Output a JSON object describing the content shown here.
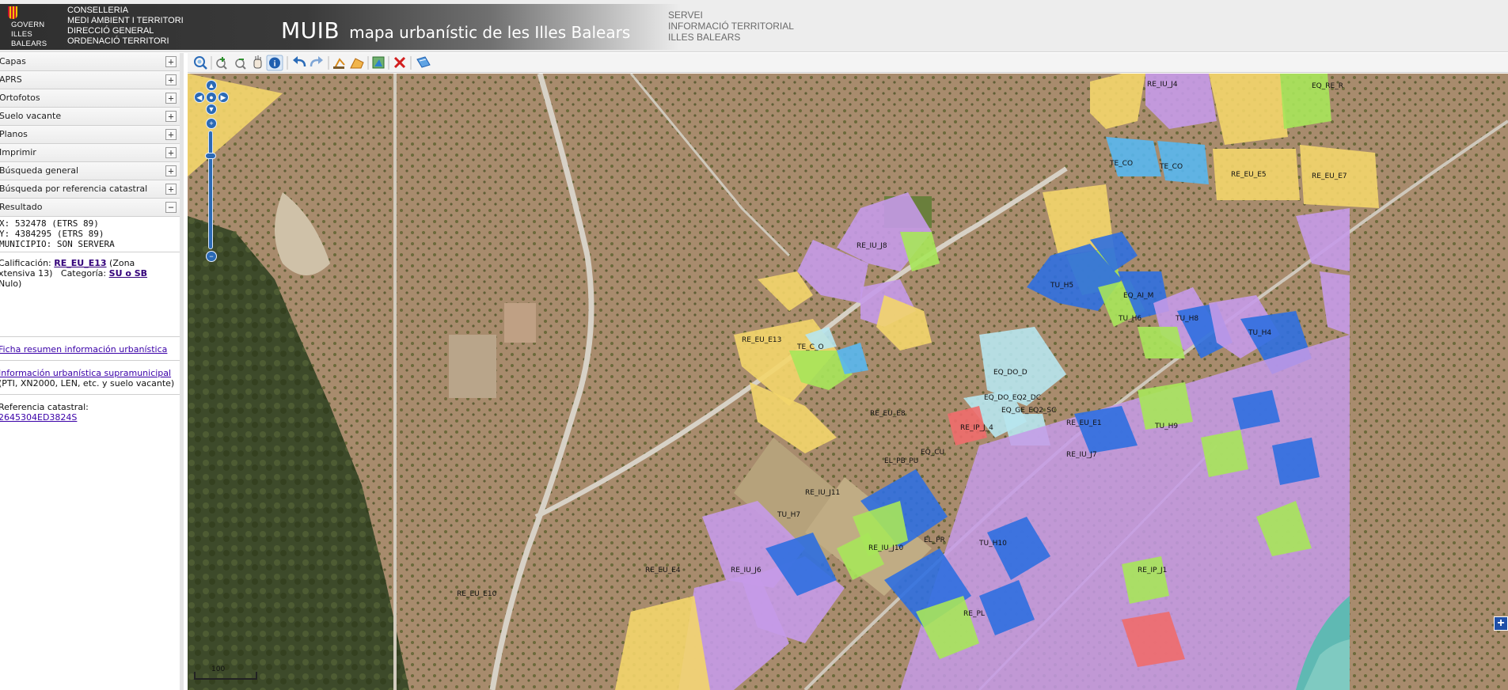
{
  "header": {
    "gov_logo_lines": [
      "GOVERN",
      "ILLES",
      "BALEARS"
    ],
    "conselleria_lines": [
      "CONSELLERIA",
      "MEDI AMBIENT I TERRITORI",
      "DIRECCIÓ GENERAL",
      "ORDENACIÓ TERRITORI"
    ],
    "app_name": "MUIB",
    "app_subtitle": "mapa urbanístic de les Illes Balears",
    "servei_lines": [
      "SERVEI",
      "INFORMACIÓ TERRITORIAL",
      "ILLES BALEARS"
    ]
  },
  "sidebar": {
    "items": [
      {
        "label": "Capas",
        "toggle": "+"
      },
      {
        "label": "APRS",
        "toggle": "+"
      },
      {
        "label": "Ortofotos",
        "toggle": "+"
      },
      {
        "label": "Suelo vacante",
        "toggle": "+"
      },
      {
        "label": "Planos",
        "toggle": "+"
      },
      {
        "label": "Imprimir",
        "toggle": "+"
      },
      {
        "label": "Búsqueda general",
        "toggle": "+"
      },
      {
        "label": "Búsqueda por referencia catastral",
        "toggle": "+"
      },
      {
        "label": "Resultado",
        "toggle": "−"
      }
    ],
    "result": {
      "x": "X: 532478 (ETRS 89)",
      "y": "Y: 4384295 (ETRS 89)",
      "municipio": "MUNICIPIO: SON SERVERA",
      "calif_prefix": "Calificación:",
      "calif_link": "RE_EU_E13",
      "calif_desc": "(Zona",
      "calif_desc2": "xtensiva 13)",
      "categoria_prefix": "Categoría:",
      "categoria_link": "SU o SB",
      "calif_desc3": "Nulo)",
      "ficha_link": "Ficha resumen información urbanística",
      "supra_link": "Información urbanística supramunicipal",
      "supra_text": "(PTI, XN2000, LEN, etc. y suelo vacante)",
      "ref_label": "Referencia catastral:",
      "ref_link": "2645304ED3824S"
    }
  },
  "toolbar": {
    "buttons": [
      {
        "name": "zoom-extent-icon",
        "color": "#2a6bb8"
      },
      {
        "name": "zoom-in-icon",
        "color": "#2f8f2f"
      },
      {
        "name": "zoom-out-icon",
        "color": "#2f8f2f"
      },
      {
        "name": "pan-hand-icon",
        "color": "#555555"
      },
      {
        "name": "info-icon",
        "color": "#1f5fb0"
      },
      {
        "name": "undo-icon",
        "color": "#2a6bb8"
      },
      {
        "name": "redo-icon",
        "color": "#2a6bb8"
      },
      {
        "name": "measure-distance-icon",
        "color": "#d78a1c"
      },
      {
        "name": "measure-area-icon",
        "color": "#d78a1c"
      },
      {
        "name": "print-map-icon",
        "color": "#3b8a3b"
      },
      {
        "name": "clear-icon",
        "color": "#d21f1f"
      },
      {
        "name": "help-book-icon",
        "color": "#2a6bb8"
      }
    ]
  },
  "map": {
    "scale_label": "100",
    "layer_switch_symbol": "+",
    "zone_labels": [
      "RE_IU_J4",
      "TE_CO",
      "TE_CO",
      "RE_EU_E5",
      "RE_EU_E7",
      "EQ_RE_R",
      "RE_IU_J8",
      "TU_H5",
      "EQ_AI_M",
      "TU_H6",
      "TU_H8",
      "TU_H4",
      "RE_EU_E13",
      "TE_C_O",
      "RE_EU_E8",
      "EQ_DO_D",
      "RE_EU_E1",
      "EQ_DO_EQ2_DC",
      "EQ_GE_EQ2_SC",
      "RE_IP_J_4",
      "TU_H9",
      "EQ_CU",
      "EL_PB_PU",
      "RE_IU_J7",
      "RE_IU_J11",
      "TU_H7",
      "EL_PR",
      "RE_IU_J10",
      "TU_H10",
      "RE_EU_E4",
      "RE_IU_J6",
      "RE_EU_E10",
      "RE_IP_J1",
      "RE_PL"
    ],
    "colors": {
      "ri_violet": "#c59ae8",
      "ri_yellow": "#f3d56a",
      "tu_blue": "#2f6fe0",
      "green": "#a7e65a",
      "eq_lightblue": "#b7e6ee",
      "eq_red": "#ef6b6b",
      "te_blue": "#58b7ef"
    }
  }
}
